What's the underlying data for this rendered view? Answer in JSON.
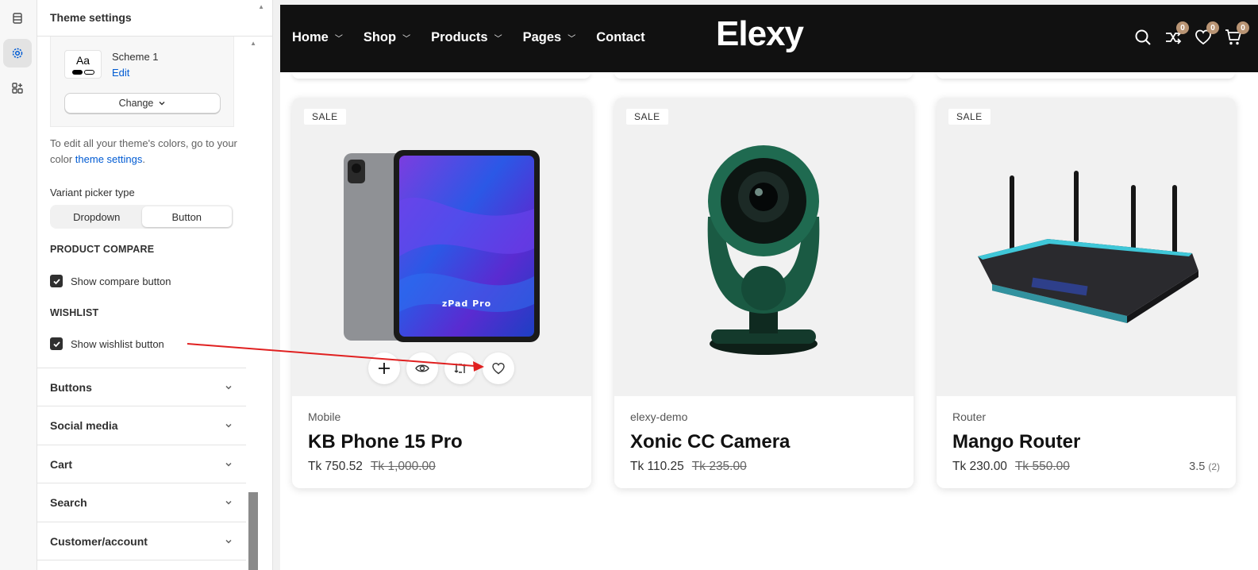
{
  "editor": {
    "title": "Theme settings",
    "rail": [
      "sections-icon",
      "gear-icon",
      "apps-icon"
    ],
    "scheme": {
      "chip_text": "Aa",
      "name": "Scheme 1",
      "edit_label": "Edit",
      "change_label": "Change"
    },
    "hint": {
      "pre": "To edit all your theme's colors, go to your color ",
      "link": "theme settings",
      "post": "."
    },
    "variant_picker": {
      "label": "Variant picker type",
      "options": [
        "Dropdown",
        "Button"
      ],
      "selected": "Button"
    },
    "product_compare": {
      "title": "PRODUCT COMPARE",
      "checkbox_label": "Show compare button",
      "checked": true
    },
    "wishlist": {
      "title": "WISHLIST",
      "checkbox_label": "Show wishlist button",
      "checked": true
    },
    "accordions": [
      "Buttons",
      "Social media",
      "Cart",
      "Search",
      "Customer/account"
    ]
  },
  "store": {
    "nav": [
      "Home",
      "Shop",
      "Products",
      "Pages",
      "Contact"
    ],
    "nav_dropdowns": [
      true,
      true,
      true,
      true,
      false
    ],
    "logo": "Elexy",
    "compare_count": "0",
    "wishlist_count": "0",
    "cart_count": "0",
    "badge_color": "#b89474",
    "products": [
      {
        "badge": "SALE",
        "category": "Mobile",
        "name": "KB Phone 15 Pro",
        "price": "Tk 750.52",
        "old_price": "Tk 1,000.00",
        "rating": "",
        "reviews": "",
        "image_text": "zPad Pro"
      },
      {
        "badge": "SALE",
        "category": "elexy-demo",
        "name": "Xonic CC Camera",
        "price": "Tk 110.25",
        "old_price": "Tk 235.00",
        "rating": "",
        "reviews": ""
      },
      {
        "badge": "SALE",
        "category": "Router",
        "name": "Mango Router",
        "price": "Tk 230.00",
        "old_price": "Tk 550.00",
        "rating": "3.5",
        "reviews": "(2)"
      }
    ]
  },
  "colors": {
    "accent_link": "#005bd3",
    "nav_bg": "#111111",
    "annotation_arrow": "#e02020"
  }
}
